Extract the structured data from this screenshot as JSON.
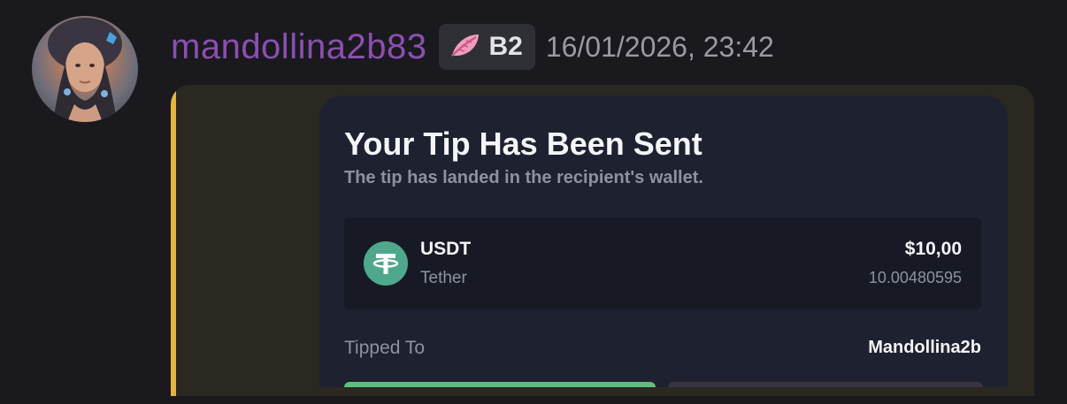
{
  "message": {
    "author": "mandollina2b83",
    "badge_label": "B2",
    "badge_icon": "pink-feather-icon",
    "timestamp": "16/01/2026, 23:42",
    "colors": {
      "author": "#8b4fb0",
      "embed_accent": "#e7b23d",
      "tether": "#4ea98c",
      "confirm_button": "#5fbf7f"
    }
  },
  "card": {
    "title": "Your Tip Has Been Sent",
    "subtitle": "The tip has landed in the recipient's wallet.",
    "asset": {
      "symbol": "USDT",
      "name": "Tether",
      "fiat_value": "$10,00",
      "amount": "10.00480595",
      "icon": "tether-icon"
    },
    "tipped_to_label": "Tipped To",
    "tipped_to_value": "Mandollina2b"
  }
}
